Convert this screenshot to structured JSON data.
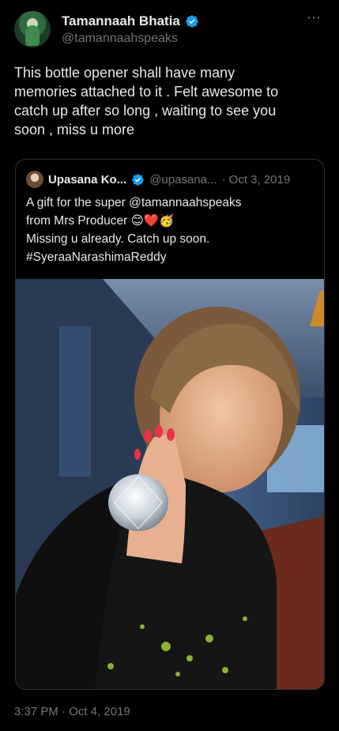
{
  "author": {
    "display_name": "Tamannaah Bhatia",
    "handle": "@tamannaahspeaks"
  },
  "menu": {
    "more_icon": "⋯"
  },
  "tweet": {
    "text": "This bottle opener shall have many\nmemories attached to it . Felt awesome to\ncatch up after so long , waiting to see you\nsoon , miss u more",
    "timestamp": "3:37 PM · Oct 4, 2019"
  },
  "quoted": {
    "display_name": "Upasana Ko...",
    "handle": "@upasana...",
    "date": "· Oct 3, 2019",
    "text": "A  gift for the super @tamannaahspeaks\nfrom Mrs Producer 😊❤️🥳\nMissing u already. Catch up soon.\n#SyeraaNarashimaReddy",
    "media": "photo"
  },
  "colors": {
    "background": "#000000",
    "text": "#e7e9ea",
    "secondary": "#71767b",
    "verified": "#1d9bf0",
    "border": "#2f3336"
  }
}
